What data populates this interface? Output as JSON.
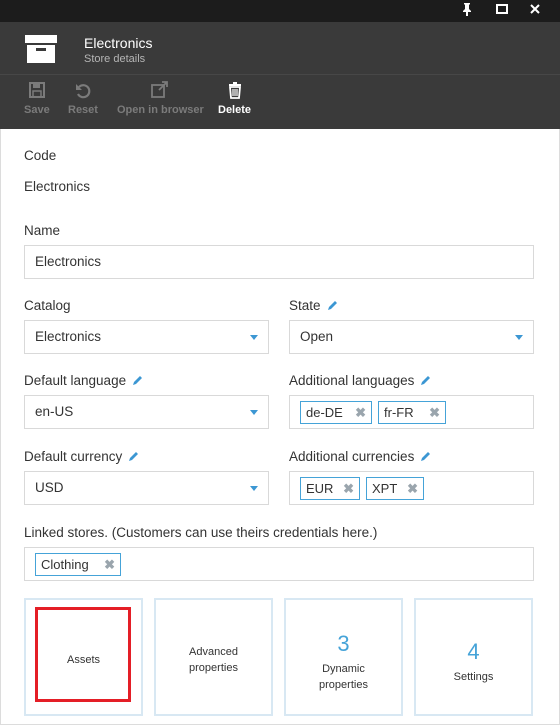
{
  "window": {
    "controls": [
      {
        "name": "pin-icon"
      },
      {
        "name": "maximize-icon"
      },
      {
        "name": "close-icon"
      }
    ]
  },
  "header": {
    "title": "Electronics",
    "subtitle": "Store details",
    "icon": "archive-box-icon"
  },
  "toolbar": {
    "save_label": "Save",
    "reset_label": "Reset",
    "open_label": "Open in browser",
    "delete_label": "Delete"
  },
  "form": {
    "code_label": "Code",
    "code_value": "Electronics",
    "name_label": "Name",
    "name_value": "Electronics",
    "catalog_label": "Catalog",
    "catalog_value": "Electronics",
    "state_label": "State",
    "state_value": "Open",
    "default_language_label": "Default language",
    "default_language_value": "en-US",
    "additional_languages_label": "Additional languages",
    "additional_languages": [
      "de-DE",
      "fr-FR"
    ],
    "default_currency_label": "Default currency",
    "default_currency_value": "USD",
    "additional_currencies_label": "Additional currencies",
    "additional_currencies": [
      "EUR",
      "XPT"
    ],
    "linked_stores_label": "Linked stores. (Customers can use theirs credentials here.)",
    "linked_stores": [
      "Clothing"
    ]
  },
  "tiles": {
    "assets": "Assets",
    "advanced_line1": "Advanced",
    "advanced_line2": "properties",
    "dynamic_count": "3",
    "dynamic_line1": "Dynamic",
    "dynamic_line2": "properties",
    "settings_count": "4",
    "settings_label": "Settings"
  },
  "colors": {
    "accent": "#45a3d8",
    "header_bg": "#3a3a3a",
    "highlight": "#e41e26"
  }
}
